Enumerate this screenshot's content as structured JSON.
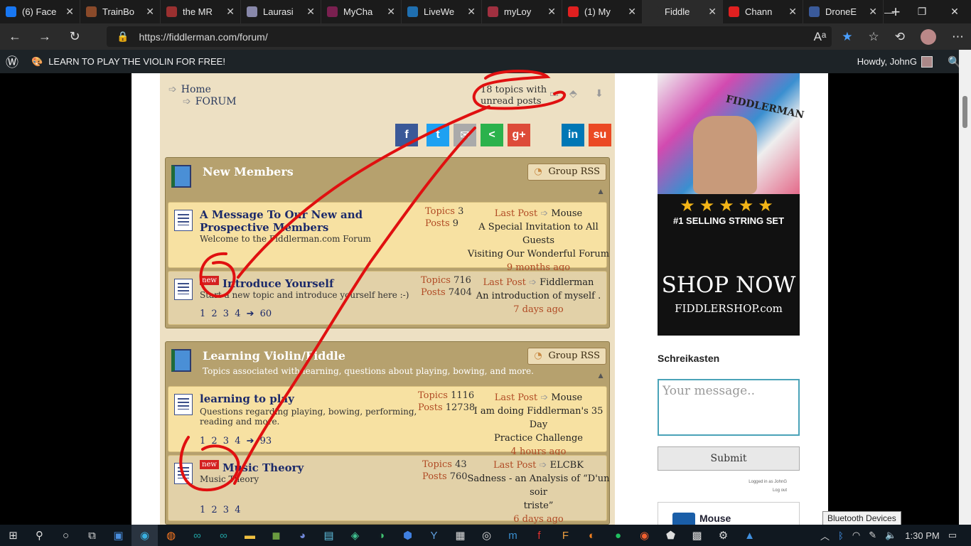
{
  "browser": {
    "tabs": [
      {
        "title": "(6) Face",
        "icon": "facebook-icon",
        "color": "#1877f2"
      },
      {
        "title": "TrainBo",
        "icon": "trainbo-icon",
        "color": "#8a4a2a"
      },
      {
        "title": "the MR",
        "icon": "mr-icon",
        "color": "#9a3030"
      },
      {
        "title": "Laurasi",
        "icon": "laurasi-icon",
        "color": "#8888aa"
      },
      {
        "title": "MyCha",
        "icon": "mycha-icon",
        "color": "#7a2050"
      },
      {
        "title": "LiveWe",
        "icon": "livewe-icon",
        "color": "#1f6fb0"
      },
      {
        "title": "myLoy",
        "icon": "myloy-icon",
        "color": "#a03040"
      },
      {
        "title": "(1) My",
        "icon": "youtube-icon",
        "color": "#e02020"
      },
      {
        "title": "Fiddle",
        "icon": "wordpress-icon",
        "color": "#2b2b2b"
      },
      {
        "title": "Chann",
        "icon": "youtube-icon",
        "color": "#e02020"
      },
      {
        "title": "DroneE",
        "icon": "drone-icon",
        "color": "#3a5a9a"
      }
    ],
    "url": "https://fiddlerman.com/forum/"
  },
  "wpbar": {
    "site_title": "LEARN TO PLAY THE VIOLIN FOR FREE!",
    "howdy": "Howdy, JohnG"
  },
  "forum": {
    "crumbs": [
      "Home",
      "FORUM"
    ],
    "unread_line1": "18 topics with",
    "unread_line2": "unread posts",
    "share_buttons": [
      {
        "label": "f",
        "color": "#3b5998",
        "icon": "facebook-share-icon"
      },
      {
        "label": "t",
        "color": "#1da1f2",
        "icon": "twitter-share-icon"
      },
      {
        "label": "✉",
        "color": "#aaaaaa",
        "icon": "email-share-icon"
      },
      {
        "label": "<",
        "color": "#2bb24c",
        "icon": "share-icon"
      },
      {
        "label": "g+",
        "color": "#dd4b39",
        "icon": "googleplus-share-icon"
      },
      {
        "label": "in",
        "color": "#0077b5",
        "icon": "linkedin-share-icon"
      },
      {
        "label": "su",
        "color": "#eb4924",
        "icon": "stumbleupon-share-icon"
      }
    ],
    "groups": [
      {
        "title": "New Members",
        "desc": "",
        "rss": "Group RSS",
        "forums": [
          {
            "title1": "A Message To Our New and",
            "title2": "Prospective Members",
            "desc1": "Welcome to the Fiddlerman.com Forum",
            "desc2": "",
            "new": "",
            "topics_label": "Topics",
            "topics": "3",
            "posts_label": "Posts",
            "posts": "9",
            "last_label": "Last Post",
            "last_user": "Mouse",
            "last_title1": "A Special Invitation to All Guests",
            "last_title2": "Visiting Our Wonderful Forum",
            "last_ago": "9 months ago",
            "pages": ""
          },
          {
            "title1": "Introduce Yourself",
            "title2": "",
            "desc1": "Start a new topic and introduce yourself here :-)",
            "desc2": "",
            "new": "new",
            "topics_label": "Topics",
            "topics": "716",
            "posts_label": "Posts",
            "posts": "7404",
            "last_label": "Last Post",
            "last_user": "Fiddlerman",
            "last_title1": "An introduction of myself .",
            "last_title2": "",
            "last_ago": "7 days ago",
            "pages": "1 2 3 4 ➔ 60"
          }
        ]
      },
      {
        "title": "Learning Violin/Fiddle",
        "desc": "Topics associated with learning, questions about playing, bowing, and more.",
        "rss": "Group RSS",
        "forums": [
          {
            "title1": "learning to play",
            "title2": "",
            "desc1": "Questions regarding playing, bowing, performing,",
            "desc2": "reading and more.",
            "new": "",
            "topics_label": "Topics",
            "topics": "1116",
            "posts_label": "Posts",
            "posts": "12738",
            "last_label": "Last Post",
            "last_user": "Mouse",
            "last_title1": "I am doing Fiddlerman's 35 Day",
            "last_title2": "Practice Challenge",
            "last_ago": "4 hours ago",
            "pages": "1 2 3 4 ➔ 93"
          },
          {
            "title1": "Music Theory",
            "title2": "",
            "desc1": "Music Theory",
            "desc2": "",
            "new": "new",
            "topics_label": "Topics",
            "topics": "43",
            "posts_label": "Posts",
            "posts": "760",
            "last_label": "Last Post",
            "last_user": "ELCBK",
            "last_title1": "Sadness - an Analysis of “D'un soir",
            "last_title2": "triste”",
            "last_ago": "6 days ago",
            "pages": "1 2 3 4"
          }
        ]
      }
    ]
  },
  "sidebar": {
    "ad_sell": "#1 SELLING STRING SET",
    "ad_shop": "SHOP NOW",
    "ad_brand": "FIDDLERSHOP.com",
    "ad_stars": "★★★★★",
    "ad_pack": "FIDDLERMAN",
    "shoutbox_title": "Schreikasten",
    "message_placeholder": "Your message..",
    "submit": "Submit",
    "logged_in": "Logged in as JohnG",
    "logout": "Log out",
    "mouse_name": "Mouse"
  },
  "tooltip": "Bluetooth Devices",
  "taskbar": {
    "time": "1:30 PM"
  },
  "colors": {
    "forum_bg": "#ede0c3",
    "group_header": "#b6a16e",
    "row": "#f7e1a2",
    "scribble": "#e01010"
  }
}
